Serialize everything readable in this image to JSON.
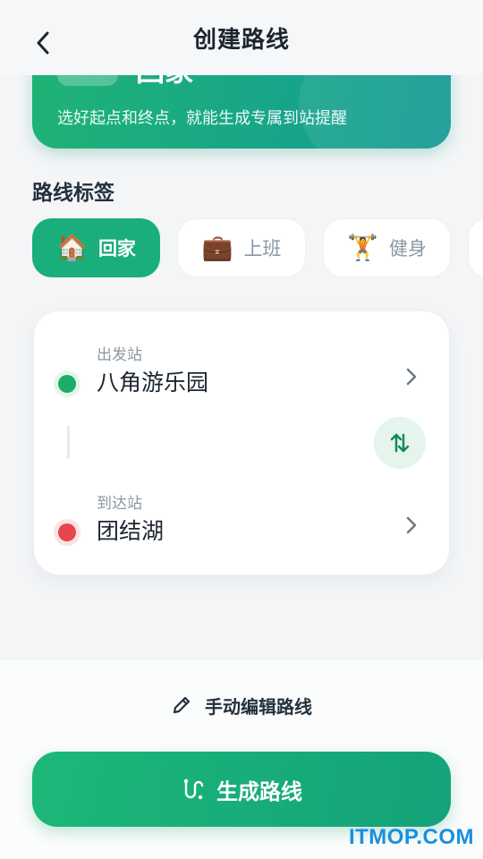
{
  "header": {
    "title": "创建路线"
  },
  "hero": {
    "title": "回家",
    "subtitle": "选好起点和终点，就能生成专属到站提醒"
  },
  "tags": {
    "section_label": "路线标签",
    "items": [
      {
        "emoji": "🏠",
        "label": "回家",
        "active": true
      },
      {
        "emoji": "💼",
        "label": "上班",
        "active": false
      },
      {
        "emoji": "🏋️",
        "label": "健身",
        "active": false
      }
    ]
  },
  "route": {
    "origin": {
      "label": "出发站",
      "name": "八角游乐园",
      "color": "#1aae6a"
    },
    "destination": {
      "label": "到达站",
      "name": "团结湖",
      "color": "#e5474b"
    }
  },
  "actions": {
    "manual_edit_label": "手动编辑路线",
    "generate_label": "生成路线"
  },
  "watermark": "ITMOP.COM"
}
